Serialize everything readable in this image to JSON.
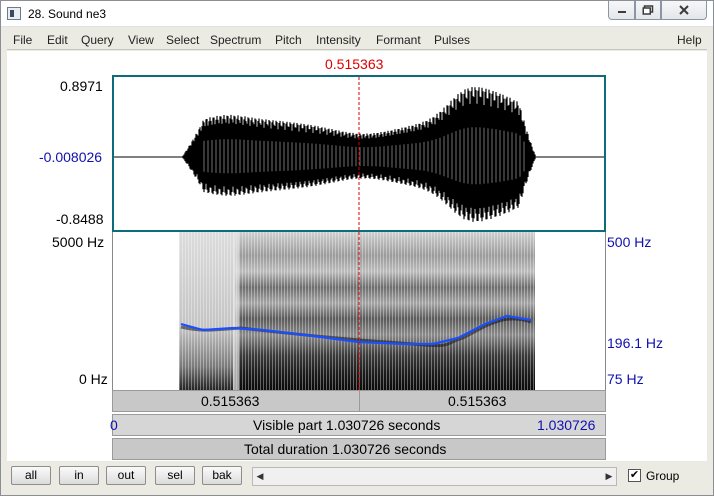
{
  "window": {
    "title": "28. Sound ne3"
  },
  "menu": [
    "File",
    "Edit",
    "Query",
    "View",
    "Select",
    "Spectrum",
    "Pitch",
    "Intensity",
    "Formant",
    "Pulses",
    "Help"
  ],
  "cursor_time": "0.515363",
  "waveform": {
    "y_max": "0.8971",
    "y_zero": "-0.008026",
    "y_min": "-0.8488"
  },
  "spectrogram": {
    "freq_top": "5000 Hz",
    "freq_bottom": "0 Hz",
    "pitch_top": "500 Hz",
    "pitch_current": "196.1 Hz",
    "pitch_bottom": "75 Hz"
  },
  "bars": {
    "left_segment": "0.515363",
    "right_segment": "0.515363",
    "visible_start": "0",
    "visible_label": "Visible part 1.030726 seconds",
    "visible_end": "1.030726",
    "total_label": "Total duration 1.030726 seconds"
  },
  "buttons": {
    "all": "all",
    "in": "in",
    "out": "out",
    "sel": "sel",
    "bak": "bak"
  },
  "group": {
    "label": "Group",
    "checked": true,
    "mark": "✔"
  },
  "colors": {
    "cursor": "#dd0000",
    "pitch": "#1a4fff",
    "axis_blue": "#1010b0",
    "box_border": "#0e6c7a"
  }
}
